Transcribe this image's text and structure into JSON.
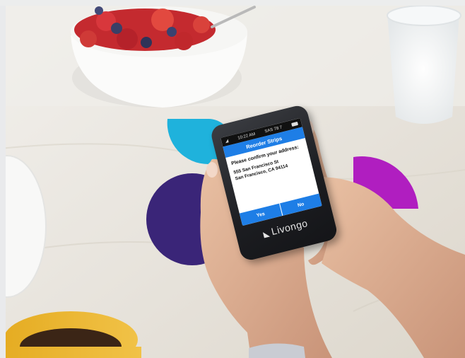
{
  "device": {
    "status_time": "10:22 AM",
    "status_signal": "SAS 78 7",
    "screen_title": "Reorder Strips",
    "message": "Please confirm your address:",
    "address_line1": "555 San Francisco St",
    "address_line2": "San Francisco, CA 94114",
    "yes_label": "Yes",
    "no_label": "No",
    "brand": "Livongo",
    "brand_icon": "livongo-logo-icon"
  },
  "colors": {
    "cyan_drop": "#1fb2dc",
    "purple_circle": "#3a2578",
    "magenta_semicircle": "#b01ec0",
    "screen_blue": "#1e7ee6"
  }
}
